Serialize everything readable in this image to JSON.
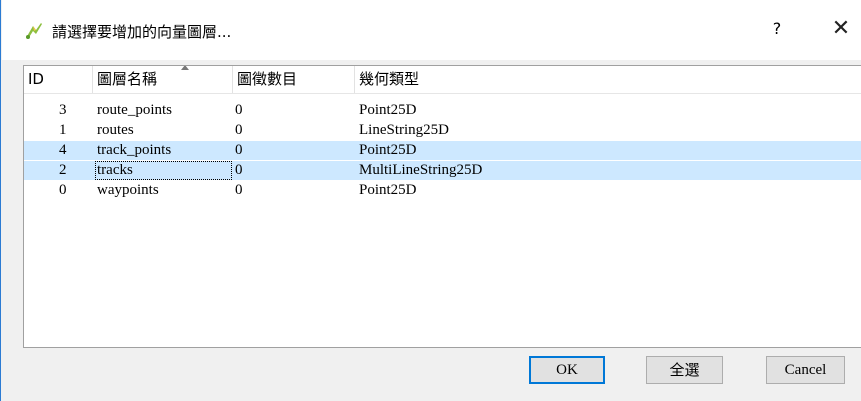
{
  "window": {
    "title": "請選擇要增加的向量圖層...",
    "help_label": "?",
    "close_label": "✕"
  },
  "table": {
    "headers": [
      "ID",
      "圖層名稱",
      "圖徵數目",
      "幾何類型"
    ],
    "rows": [
      {
        "id": "3",
        "name": "route_points",
        "count": "0",
        "geometry": "Point25D",
        "selected": false
      },
      {
        "id": "1",
        "name": "routes",
        "count": "0",
        "geometry": "LineString25D",
        "selected": false
      },
      {
        "id": "4",
        "name": "track_points",
        "count": "0",
        "geometry": "Point25D",
        "selected": true
      },
      {
        "id": "2",
        "name": "tracks",
        "count": "0",
        "geometry": "MultiLineString25D",
        "selected": true
      },
      {
        "id": "0",
        "name": "waypoints",
        "count": "0",
        "geometry": "Point25D",
        "selected": false
      }
    ]
  },
  "buttons": {
    "ok": "OK",
    "select_all": "全選",
    "cancel": "Cancel"
  },
  "colors": {
    "selection": "#cde8ff",
    "accent": "#0078d7"
  }
}
